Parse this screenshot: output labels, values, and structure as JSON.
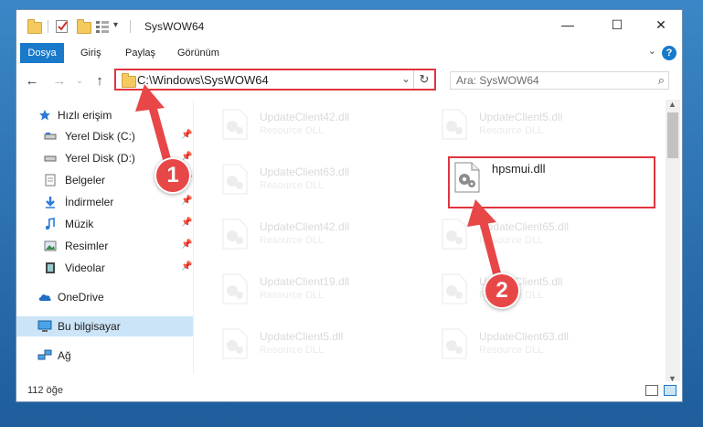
{
  "window": {
    "title": "SysWOW64",
    "controls": {
      "minimize": "—",
      "maximize": "☐",
      "close": "✕"
    }
  },
  "ribbon": {
    "tabs": [
      {
        "label": "Dosya",
        "active": true
      },
      {
        "label": "Giriş",
        "active": false
      },
      {
        "label": "Paylaş",
        "active": false
      },
      {
        "label": "Görünüm",
        "active": false
      }
    ],
    "help": "?"
  },
  "address": {
    "path": "C:\\Windows\\SysWOW64"
  },
  "search": {
    "placeholder": "Ara: SysWOW64"
  },
  "nav": {
    "items": [
      {
        "label": "Hızlı erişim",
        "icon": "star-icon",
        "pinned": false
      },
      {
        "label": "Yerel Disk (C:)",
        "icon": "drive-icon",
        "pinned": true
      },
      {
        "label": "Yerel Disk (D:)",
        "icon": "drive-icon",
        "pinned": true
      },
      {
        "label": "Belgeler",
        "icon": "documents-icon",
        "pinned": true
      },
      {
        "label": "İndirmeler",
        "icon": "download-icon",
        "pinned": true
      },
      {
        "label": "Müzik",
        "icon": "music-icon",
        "pinned": true
      },
      {
        "label": "Resimler",
        "icon": "pictures-icon",
        "pinned": true
      },
      {
        "label": "Videolar",
        "icon": "videos-icon",
        "pinned": true
      },
      {
        "label": "OneDrive",
        "icon": "cloud-icon",
        "pinned": false
      },
      {
        "label": "Bu bilgisayar",
        "icon": "computer-icon",
        "pinned": false,
        "selected": true
      },
      {
        "label": "Ağ",
        "icon": "network-icon",
        "pinned": false
      }
    ]
  },
  "files": [
    {
      "name": "UpdateClient42.dll",
      "desc": "Resource DLL",
      "col": 0,
      "row": 0,
      "faded": true
    },
    {
      "name": "UpdateClient5.dll",
      "desc": "Resource DLL",
      "col": 1,
      "row": 0,
      "faded": true
    },
    {
      "name": "UpdateClient63.dll",
      "desc": "Resource DLL",
      "col": 0,
      "row": 1,
      "faded": true
    },
    {
      "name": "hpsmui.dll",
      "desc": "",
      "col": 1,
      "row": 1,
      "faded": false,
      "highlighted": true
    },
    {
      "name": "UpdateClient42.dll",
      "desc": "Resource DLL",
      "col": 0,
      "row": 2,
      "faded": true
    },
    {
      "name": "UpdateClient65.dll",
      "desc": "Resource DLL",
      "col": 1,
      "row": 2,
      "faded": true
    },
    {
      "name": "UpdateClient19.dll",
      "desc": "Resource DLL",
      "col": 0,
      "row": 3,
      "faded": true
    },
    {
      "name": "UpdateClient5.dll",
      "desc": "Resource DLL",
      "col": 1,
      "row": 3,
      "faded": true
    },
    {
      "name": "UpdateClient5.dll",
      "desc": "Resource DLL",
      "col": 0,
      "row": 4,
      "faded": true
    },
    {
      "name": "UpdateClient63.dll",
      "desc": "Resource DLL",
      "col": 1,
      "row": 4,
      "faded": true
    }
  ],
  "status": {
    "count": "112 öğe"
  },
  "annotations": [
    {
      "label": "1"
    },
    {
      "label": "2"
    }
  ],
  "colors": {
    "accent": "#1979ca",
    "highlight": "#e0363d",
    "badge": "#e84747"
  }
}
